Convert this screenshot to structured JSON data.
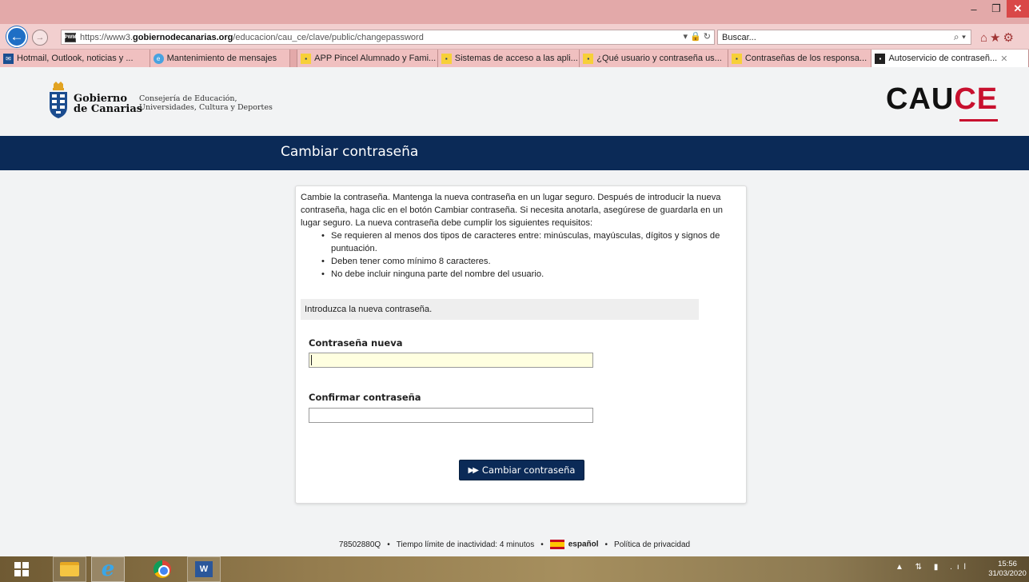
{
  "browser": {
    "url_prefix": "https://www3.",
    "url_domain": "gobiernodecanarias.org",
    "url_path": "/educacion/cau_ce/clave/public/changepassword",
    "url_tools": "▾ 🔒 ↻",
    "favicon_label": "PWM",
    "search_placeholder": "Buscar...",
    "tabs": [
      {
        "label": "Hotmail, Outlook, noticias y ..."
      },
      {
        "label": "Mantenimiento de mensajes"
      },
      {
        "label": "APP Pincel Alumnado y Fami..."
      },
      {
        "label": "Sistemas de acceso a las apli..."
      },
      {
        "label": "¿Qué usuario y contraseña us..."
      },
      {
        "label": "Contraseñas de los responsa..."
      },
      {
        "label": "Autoservicio de contraseñ..."
      }
    ]
  },
  "header": {
    "org_name_line1": "Gobierno",
    "org_name_line2": "de Canarias",
    "dept_line1": "Consejería de Educación,",
    "dept_line2": "Universidades, Cultura y Deportes",
    "app_logo_main": "CAU",
    "app_logo_accent": "CE"
  },
  "page": {
    "title": "Cambiar contraseña"
  },
  "form": {
    "intro": "Cambie la contraseña. Mantenga la nueva contraseña en un lugar seguro. Después de introducir la nueva contraseña, haga clic en el botón Cambiar contraseña. Si necesita anotarla, asegúrese de guardarla en un lugar seguro. La nueva contraseña debe cumplir los siguientes requisitos:",
    "requirements": [
      "Se requieren al menos dos tipos de caracteres entre: minúsculas, mayúsculas, dígitos y signos de puntuación.",
      "Deben tener como mínimo 8 caracteres.",
      "No debe incluir ninguna parte del nombre del usuario."
    ],
    "notice": "Introduzca la nueva contraseña.",
    "new_password_label": "Contraseña nueva",
    "new_password_value": "",
    "confirm_password_label": "Confirmar contraseña",
    "confirm_password_value": "",
    "submit_label": "Cambiar contraseña"
  },
  "footer": {
    "user_id": "78502880Q",
    "timeout": "Tiempo límite de inactividad: 4 minutos",
    "language": "español",
    "privacy": "Política de privacidad",
    "separator": "•"
  },
  "taskbar": {
    "time": "15:56",
    "date": "31/03/2020"
  },
  "colors": {
    "title_band": "#0b2a57",
    "accent_red": "#c8102e",
    "browser_chrome": "#e3a9a9"
  }
}
